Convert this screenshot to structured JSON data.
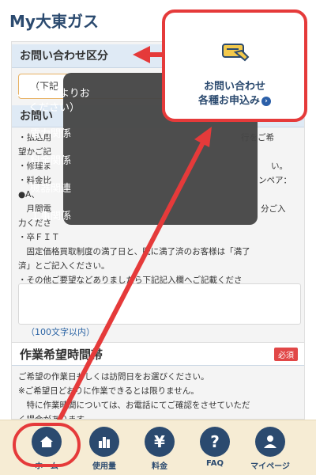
{
  "app": {
    "title": "My大東ガス"
  },
  "form": {
    "section1_title": "お問い合わせ区分",
    "select_value": "（下記",
    "section2_title": "お問い",
    "desc_lines": [
      "・払込用",
      "望かご記",
      "・修理ま",
      "・料金比",
      "●A、",
      "　月間電",
      "力くださ",
      "・卒ＦＩＴ",
      "　固定価格買取制度の満了日と、既に満了済のお客様は「満了",
      "済」とご記入ください。",
      "・その他ご要望などありましたら下記記入欄へご記載くださ",
      "い。"
    ],
    "desc_right_fragments": [
      "行をご希",
      "い。",
      "ンペア：",
      "分ご入"
    ],
    "hint": "（100文字以内）",
    "section3_title": "作業希望時間帯",
    "required_label": "必須",
    "desc2_lines": [
      "ご希望の作業日もしくは訪問日をお選びください。",
      "※ご希望日どおりに作業できるとは限りません。",
      "　特に作業時間については、お電話にてご確認をさせていただ",
      "く場合があります。"
    ]
  },
  "dropdown": {
    "check": "✓",
    "items": [
      "（下記よりお\nください）",
      "電力関係",
      "料金関係",
      "機器関連",
      "工事関係"
    ]
  },
  "callout": {
    "line1": "お問い合わせ",
    "line2": "各種お申込み",
    "chevron": "›",
    "icon": "hand-pointing-icon"
  },
  "nav": {
    "items": [
      {
        "label": "ホーム",
        "icon": "home-icon"
      },
      {
        "label": "使用量",
        "icon": "bar-chart-icon"
      },
      {
        "label": "料金",
        "icon": "yen-icon"
      },
      {
        "label": "FAQ",
        "icon": "question-icon"
      },
      {
        "label": "マイページ",
        "icon": "person-icon"
      }
    ]
  },
  "colors": {
    "brand_navy": "#2b4a6f",
    "annotation_red": "#e53a3a",
    "nav_bg": "#f6ecd4",
    "section_bg": "#dfeaf5"
  }
}
